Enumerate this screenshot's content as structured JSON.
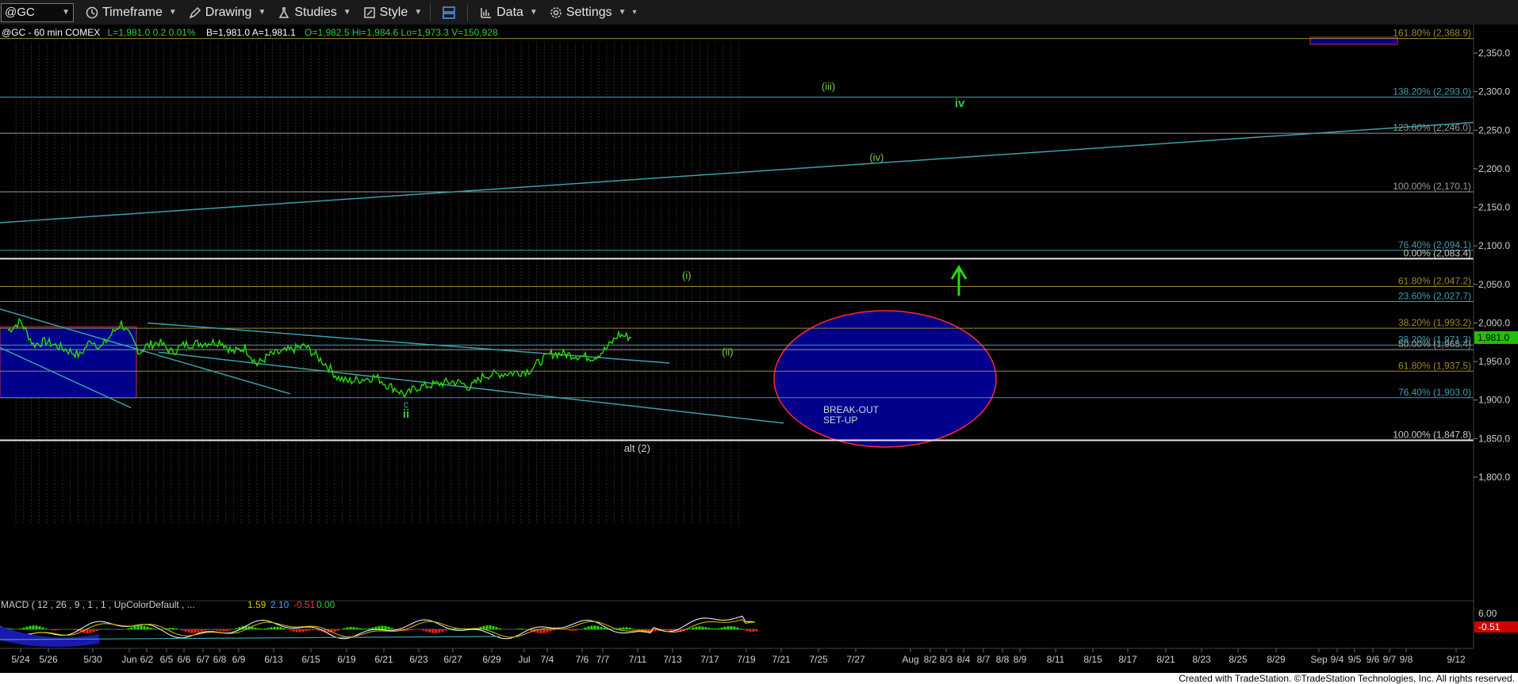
{
  "toolbar": {
    "symbol": "@GC",
    "timeframe": "Timeframe",
    "drawing": "Drawing",
    "studies": "Studies",
    "style": "Style",
    "data": "Data",
    "settings": "Settings"
  },
  "header": {
    "parts": [
      "@GC - 60 min  COMEX",
      "L=1,981.0  0.2  0.01%",
      "B=1,981.0  A=1,981.1",
      "O=1,982.5  Hi=1,984.6  Lo=1,973.3  V=150,928"
    ]
  },
  "footer": {
    "credit": "Created with TradeStation. ©TradeStation Technologies, Inc. All rights reserved."
  },
  "chart_data": {
    "type": "line",
    "symbol": "@GC",
    "interval": "60 min",
    "exchange": "COMEX",
    "last": 1981.0,
    "price_axis": {
      "ylim": [
        1780,
        2375
      ],
      "ticks": [
        1800,
        1850,
        1900,
        1950,
        2000,
        2050,
        2100,
        2150,
        2200,
        2250,
        2300,
        2350
      ],
      "tick_labels": [
        "1,800.0",
        "1,850.0",
        "1,900.0",
        "1,950.0",
        "2,000.0",
        "2,050.0",
        "2,100.0",
        "2,150.0",
        "2,200.0",
        "2,250.0",
        "2,300.0",
        "2,350.0"
      ],
      "last_label": "1,981.0"
    },
    "x_axis_labels": [
      "5/24",
      "5/26",
      "5/30",
      "Jun",
      "6/2",
      "6/5",
      "6/6",
      "6/7",
      "6/8",
      "6/9",
      "6/13",
      "6/15",
      "6/19",
      "6/21",
      "6/23",
      "6/27",
      "6/29",
      "Jul",
      "7/4",
      "7/6",
      "7/7",
      "7/11",
      "7/13",
      "7/17",
      "7/19",
      "7/21",
      "7/25",
      "7/27",
      "Aug",
      "8/2",
      "8/3",
      "8/4",
      "8/7",
      "8/8",
      "8/9",
      "8/11",
      "8/15",
      "8/17",
      "8/21",
      "8/23",
      "8/25",
      "8/29",
      "Sep",
      "9/4",
      "9/5",
      "9/6",
      "9/7",
      "9/8",
      "9/12"
    ],
    "price_path": [
      [
        "5/23",
        1990
      ],
      [
        "5/24",
        2002
      ],
      [
        "5/25",
        1972
      ],
      [
        "5/26",
        1976
      ],
      [
        "5/29",
        1958
      ],
      [
        "5/30",
        1978
      ],
      [
        "5/31",
        1968
      ],
      [
        "6/1",
        1985
      ],
      [
        "6/2",
        2000
      ],
      [
        "6/5",
        1962
      ],
      [
        "6/6",
        1970
      ],
      [
        "6/7",
        1975
      ],
      [
        "6/8",
        1962
      ],
      [
        "6/9",
        1972
      ],
      [
        "6/12",
        1976
      ],
      [
        "6/13",
        1962
      ],
      [
        "6/14",
        1968
      ],
      [
        "6/15",
        1946
      ],
      [
        "6/16",
        1958
      ],
      [
        "6/19",
        1970
      ],
      [
        "6/20",
        1956
      ],
      [
        "6/21",
        1945
      ],
      [
        "6/22",
        1930
      ],
      [
        "6/23",
        1924
      ],
      [
        "6/26",
        1930
      ],
      [
        "6/27",
        1920
      ],
      [
        "6/28",
        1914
      ],
      [
        "6/29",
        1906
      ],
      [
        "6/30",
        1916
      ],
      [
        "7/3",
        1922
      ],
      [
        "7/4",
        1924
      ],
      [
        "7/5",
        1922
      ],
      [
        "7/6",
        1916
      ],
      [
        "7/7",
        1932
      ],
      [
        "7/10",
        1936
      ],
      [
        "7/11",
        1938
      ],
      [
        "7/12",
        1950
      ],
      [
        "7/13",
        1960
      ],
      [
        "7/14",
        1960
      ],
      [
        "7/17",
        1955
      ],
      [
        "7/18",
        1966
      ],
      [
        "7/19",
        1985
      ],
      [
        "7/20",
        1981
      ]
    ],
    "fib_levels": [
      {
        "label": "161.80% (2,368.9)",
        "value": 2368.9,
        "color": "#9a8a2a"
      },
      {
        "label": "138.20% (2,293.0)",
        "value": 2293.0,
        "color": "#3aa0aa"
      },
      {
        "label": "123.60% (2,246.0)",
        "value": 2246.0,
        "color": "#9a9a9a"
      },
      {
        "label": "100.00% (2,170.1)",
        "value": 2170.1,
        "color": "#9a9a9a"
      },
      {
        "label": "76.40% (2,094.1)",
        "value": 2094.1,
        "color": "#3aa0aa"
      },
      {
        "label": "0.00% (2,083.4)",
        "value": 2083.4,
        "color": "#e6e6e6"
      },
      {
        "label": "61.80% (2,047.2)",
        "value": 2047.2,
        "color": "#9a8a2a"
      },
      {
        "label": "23.60% (2,027.7)",
        "value": 2027.7,
        "color": "#3aa0aa"
      },
      {
        "label": "38.20% (1,993.2)",
        "value": 1993.2,
        "color": "#9a8a2a"
      },
      {
        "label": "38.20% (1,971.3)",
        "value": 1971.3,
        "color": "#3aa0aa"
      },
      {
        "label": "50.00% (1,965.4)",
        "value": 1965.4,
        "color": "#9a9a9a"
      },
      {
        "label": "61.80% (1,937.5)",
        "value": 1937.5,
        "color": "#9a8a2a"
      },
      {
        "label": "76.40% (1,903.0)",
        "value": 1903.0,
        "color": "#3aa0aa"
      },
      {
        "label": "100.00% (1,847.8)",
        "value": 1847.8,
        "color": "#e6e6e6"
      }
    ],
    "wave_labels": [
      {
        "text": "(iii)",
        "date": "8/19",
        "value": 2302,
        "color": "#7ec850"
      },
      {
        "text": "iv",
        "date": "9/7",
        "value": 2280,
        "color": "#2ecc40"
      },
      {
        "text": "(iv)",
        "date": "8/26",
        "value": 2210,
        "color": "#7ec850"
      },
      {
        "text": "(i)",
        "date": "7/29",
        "value": 2057,
        "color": "#7ec850"
      },
      {
        "text": "(ii)",
        "date": "8/4",
        "value": 1958,
        "color": "#7ec850"
      },
      {
        "text": "c",
        "date": "6/29",
        "value": 1890,
        "color": "#3aa0aa"
      },
      {
        "text": "ii",
        "date": "6/29",
        "value": 1877,
        "color": "#2ecc40"
      },
      {
        "text": "alt (2)",
        "date": "7/21",
        "value": 1833,
        "color": "#cfcfcf"
      }
    ],
    "annotations": {
      "setup_text": [
        "BREAK-OUT",
        "SET-UP"
      ],
      "arrow": "up"
    },
    "macd": {
      "label": "MACD ( 12 , 26 , 9 , 1 , 1 , UpColorDefault , ...",
      "values": [
        "1.59",
        "2.10",
        "-0.51",
        "0.00"
      ],
      "colors": [
        "#d8c200",
        "#4a9cff",
        "#ff3333",
        "#2ecc40"
      ],
      "axis_labels": [
        "6.00",
        "-0.51"
      ]
    }
  }
}
